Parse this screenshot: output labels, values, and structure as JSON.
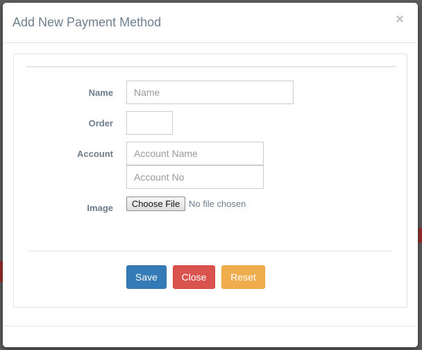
{
  "modal": {
    "title": "Add New Payment Method",
    "close_glyph": "×"
  },
  "form": {
    "name_label": "Name",
    "name_placeholder": "Name",
    "order_label": "Order",
    "account_label": "Account",
    "account_name_placeholder": "Account Name",
    "account_no_placeholder": "Account No",
    "image_label": "Image",
    "file_button_label": "Choose File",
    "file_status": "No file chosen"
  },
  "actions": {
    "save_label": "Save",
    "close_label": "Close",
    "reset_label": "Reset"
  },
  "colors": {
    "save": "#337ab7",
    "close": "#d9534f",
    "reset": "#f0ad4e",
    "label": "#6d7d8c"
  },
  "icons": {
    "close": "close-icon"
  }
}
